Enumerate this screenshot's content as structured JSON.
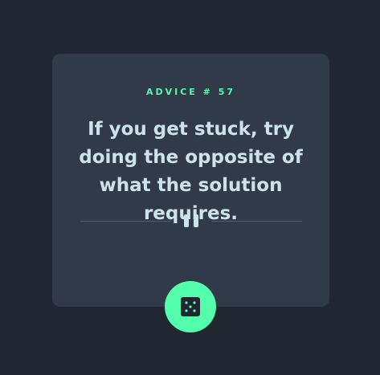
{
  "advice": {
    "label_prefix": "ADVICE #",
    "number": "57",
    "text": "If you get stuck, try doing the opposite of what the solution requires."
  },
  "colors": {
    "background": "#202632",
    "card": "#313a48",
    "accent": "#53ffaa",
    "text": "#cee3e9",
    "divider": "#4f5d74"
  },
  "icons": {
    "divider": "pause-icon",
    "button": "dice-icon"
  }
}
